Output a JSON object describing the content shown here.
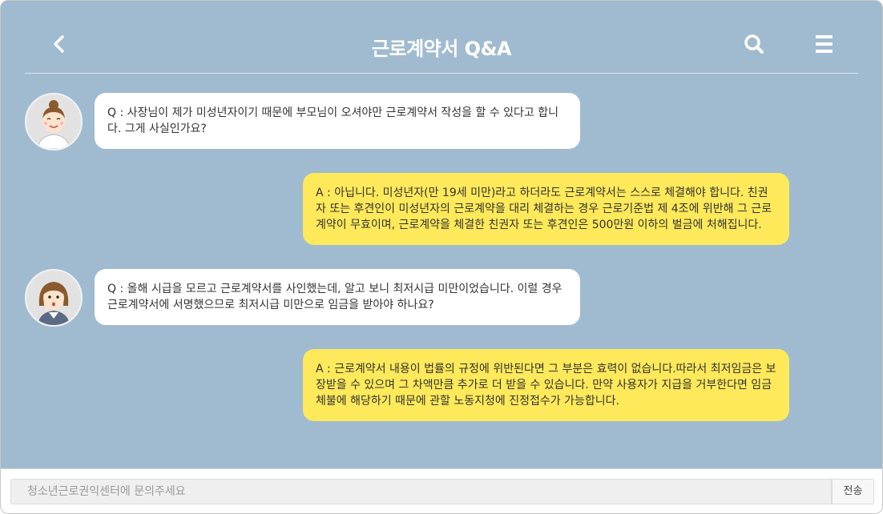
{
  "header": {
    "title": "근로계약서 Q&A",
    "back_icon": "chevron-left-icon",
    "search_icon": "search-icon",
    "menu_icon": "hamburger-menu-icon"
  },
  "messages": [
    {
      "role": "question",
      "avatar": "female-avatar-smiling",
      "text": "Q : 사장님이 제가 미성년자이기 때문에 부모님이 오셔야만 근로계약서 작성을 할 수 있다고 합니다. 그게 사실인가요?"
    },
    {
      "role": "answer",
      "text": "A : 아닙니다. 미성년자(만 19세 미만)라고 하더라도 근로계약서는 스스로 체결해야 합니다. 친권자 또는 후견인이 미성년자의 근로계약을 대리 체결하는 경우 근로기준법 제 4조에 위반해 그 근로계약이 무효이며, 근로계약을 체결한 친권자 또는 후견인은 500만원 이하의 벌금에 처해집니다."
    },
    {
      "role": "question",
      "avatar": "female-avatar-thinking",
      "text": "Q : 올해 시급을 모르고 근로계약서를 사인했는데, 알고 보니 최저시급 미만이었습니다. 이럴 경우 근로계약서에 서명했으므로 최저시급 미만으로 임금을 받아야 하나요?"
    },
    {
      "role": "answer",
      "text": "A : 근로계약서 내용이 법률의 규정에 위반된다면 그 부분은 효력이 없습니다.따라서 최저임금은 보장받을 수 있으며 그 차액만큼 추가로 더 받을 수 있습니다. 만약 사용자가 지급을 거부한다면 임금 체불에 해당하기 때문에 관할 노동지청에 진정접수가 가능합니다."
    }
  ],
  "input": {
    "placeholder": "청소년근로권익센터에 문의주세요",
    "send_label": "전송"
  },
  "colors": {
    "background": "#a0bbd0",
    "question_bubble": "#ffffff",
    "answer_bubble": "#fde95a"
  }
}
